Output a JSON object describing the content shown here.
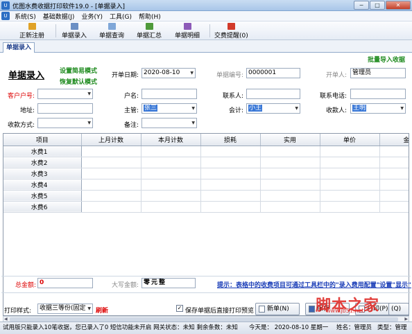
{
  "window": {
    "title": "优图水费收据打印软件19.0 - [单据录入]",
    "icon_text": "U",
    "buttons": [
      "minimize-icon",
      "maximize-icon",
      "close-icon"
    ],
    "min_glyph": "−",
    "max_glyph": "□",
    "close_glyph": "✕"
  },
  "menu": {
    "items": [
      "系统(S)",
      "基础数据(J)",
      "业务(Y)",
      "工具(G)",
      "帮助(H)"
    ]
  },
  "toolbar": {
    "register": "正新注册",
    "entry": "单据录入",
    "query": "单据查询",
    "summary": "单据汇总",
    "detail": "单据明细",
    "reminder": "交费提醒(0)"
  },
  "tab": {
    "label": "单据录入"
  },
  "form": {
    "batch_import": "批量导入收据",
    "page_title": "单据录入",
    "simple_mode": "设置简易模式",
    "default_mode": "恢复默认模式",
    "open_date_label": "开单日期:",
    "open_date_value": "2020-08-10",
    "receipt_no_label": "单据编号:",
    "receipt_no_value": "0000001",
    "opener_label": "开单人:",
    "opener_value": "管理员",
    "customer_no_label": "客户户号:",
    "customer_no_value": "",
    "name_label": "户名:",
    "name_value": "",
    "contact_label": "联系人:",
    "contact_value": "",
    "phone_label": "联系电话:",
    "phone_value": "",
    "address_label": "地址:",
    "address_value": "",
    "supervisor_label": "主管:",
    "supervisor_value": "张三",
    "accountant_label": "会计:",
    "accountant_value": "小王",
    "cashier_label": "收款人:",
    "cashier_value": "王明",
    "pay_method_label": "收款方式:",
    "pay_method_value": "",
    "remark_label": "备注:",
    "remark_value": ""
  },
  "grid": {
    "columns": [
      "项目",
      "上月计数",
      "本月计数",
      "损耗",
      "实用",
      "单价",
      "金"
    ],
    "rows": [
      "水费1",
      "水费2",
      "水费3",
      "水费4",
      "水费5",
      "水费6"
    ],
    "scroll_left": "◀",
    "scroll_right": "▶"
  },
  "totals": {
    "total_label": "总金额:",
    "total_value": "0",
    "upper_label": "大写金额:",
    "upper_value": "零元整",
    "hint": "提示：表格中的收费项目可通过工具栏中的\"录入费用配置\"设置\"显示\"项"
  },
  "bottom": {
    "print_style_label": "打印样式:",
    "print_style_value": "收据三等份(固定",
    "refresh": "刷新",
    "save_print_check": "保存单据后直接打印预览",
    "new_button": "新单(N)",
    "save_button": "保存",
    "print_button": "打印(P)",
    "close_button": "(Q)"
  },
  "status": {
    "trial_note": "试用版只能录入10笔收据，您已录入了0 短信功能未开启 网关状态：未知 剩余条数：未知",
    "today": "今天是： 2020-08-10 星期一",
    "user": "姓名：管理员",
    "type": "类型：管理"
  },
  "watermark": {
    "text": "脚本之家",
    "url": "www.jb51.net"
  },
  "colors": {
    "accent": "#1c3d8a",
    "green": "#1d8a1d",
    "red": "#d00000",
    "selection": "#3a78d7"
  }
}
